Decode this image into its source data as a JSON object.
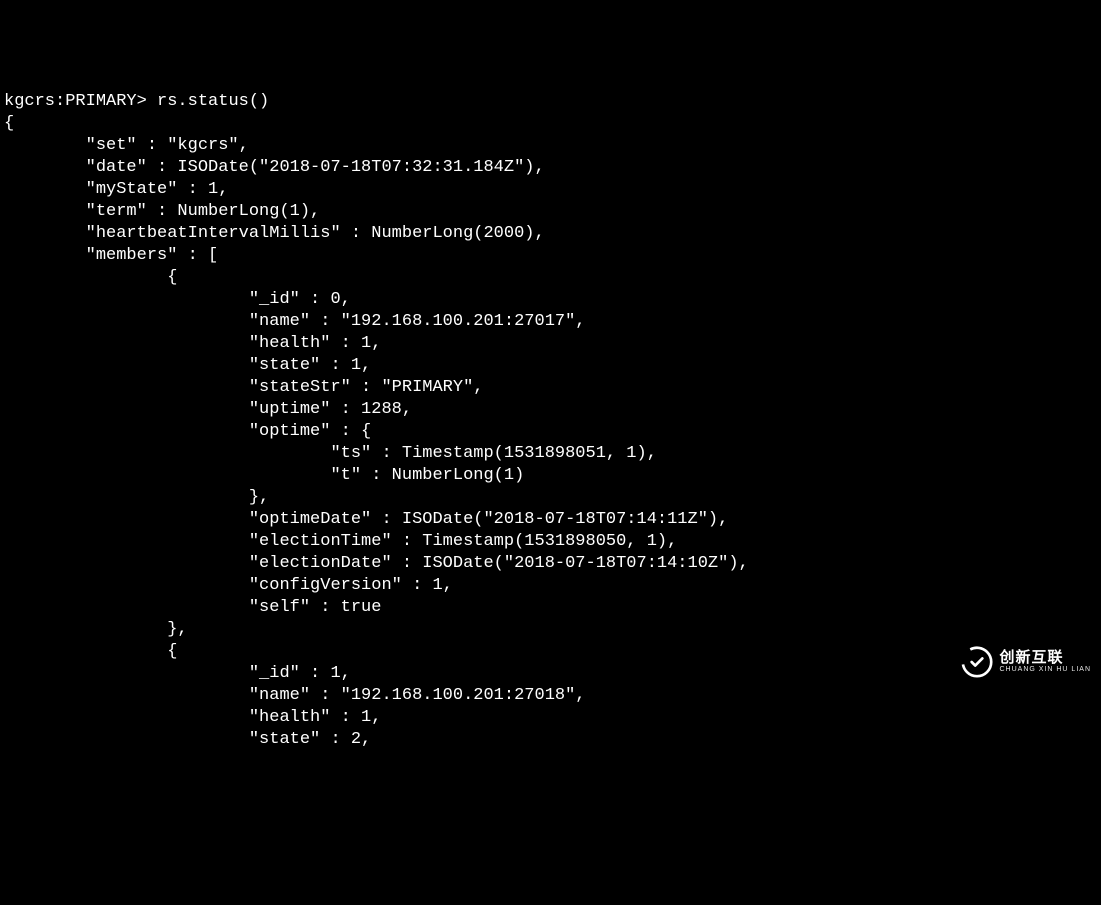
{
  "prompt_prefix": "kgcrs:PRIMARY> ",
  "command": "rs.status()",
  "output": {
    "open_brace": "{",
    "set_line": "        \"set\" : \"kgcrs\",",
    "date_line": "        \"date\" : ISODate(\"2018-07-18T07:32:31.184Z\"),",
    "mystate_line": "        \"myState\" : 1,",
    "term_line": "        \"term\" : NumberLong(1),",
    "heartbeat_line": "        \"heartbeatIntervalMillis\" : NumberLong(2000),",
    "members_line": "        \"members\" : [",
    "m0_open": "                {",
    "m0_id": "                        \"_id\" : 0,",
    "m0_name": "                        \"name\" : \"192.168.100.201:27017\",",
    "m0_health": "                        \"health\" : 1,",
    "m0_state": "                        \"state\" : 1,",
    "m0_statestr": "                        \"stateStr\" : \"PRIMARY\",",
    "m0_uptime": "                        \"uptime\" : 1288,",
    "m0_optime_open": "                        \"optime\" : {",
    "m0_optime_ts": "                                \"ts\" : Timestamp(1531898051, 1),",
    "m0_optime_t": "                                \"t\" : NumberLong(1)",
    "m0_optime_close": "                        },",
    "m0_optimedate": "                        \"optimeDate\" : ISODate(\"2018-07-18T07:14:11Z\"),",
    "m0_electiontime": "                        \"electionTime\" : Timestamp(1531898050, 1),",
    "m0_electiondate": "                        \"electionDate\" : ISODate(\"2018-07-18T07:14:10Z\"),",
    "m0_configversion": "                        \"configVersion\" : 1,",
    "m0_self": "                        \"self\" : true",
    "m0_close": "                },",
    "m1_open": "                {",
    "m1_id": "                        \"_id\" : 1,",
    "m1_name": "                        \"name\" : \"192.168.100.201:27018\",",
    "m1_health": "                        \"health\" : 1,",
    "m1_state": "                        \"state\" : 2,"
  },
  "watermark": {
    "main": "创新互联",
    "sub": "CHUANG XIN HU LIAN"
  }
}
